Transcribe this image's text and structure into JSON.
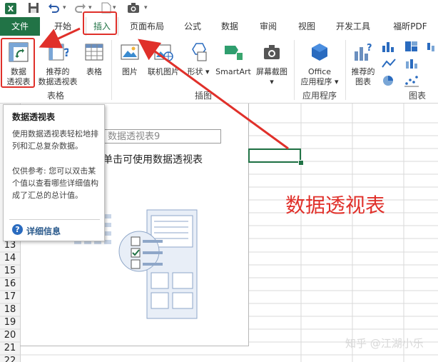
{
  "tabs": {
    "file": "文件",
    "home": "开始",
    "insert": "插入",
    "page_layout": "页面布局",
    "formulas": "公式",
    "data": "数据",
    "review": "审阅",
    "view": "视图",
    "developer": "开发工具",
    "foxit_pdf": "福昕PDF"
  },
  "ribbon": {
    "pivot_table_line1": "数据",
    "pivot_table_line2": "透视表",
    "recommended_pivot_line1": "推荐的",
    "recommended_pivot_line2": "数据透视表",
    "table": "表格",
    "tables_group": "表格",
    "pictures": "图片",
    "online_pictures": "联机图片",
    "shapes": "形状",
    "smartart": "SmartArt",
    "screenshot": "屏幕截图",
    "illustrations_group": "插图",
    "office_apps_line1": "Office",
    "office_apps_line2": "应用程序",
    "apps_group": "应用程序",
    "recommended_charts_line1": "推荐的",
    "recommended_charts_line2": "图表",
    "charts_group": "图表"
  },
  "grid": {
    "rows": [
      "13",
      "14",
      "15",
      "16",
      "17",
      "18",
      "19",
      "20",
      "21",
      "22"
    ]
  },
  "pivot_placeholder": {
    "name": "数据透视表9",
    "instruction": "单击可使用数据透视表"
  },
  "tooltip": {
    "title": "数据透视表",
    "description": "使用数据透视表轻松地排列和汇总复杂数据。",
    "note": "仅供参考: 您可以双击某个值以查看哪些详细值构成了汇总的总计值。",
    "more_info": "详细信息"
  },
  "annotation": {
    "label": "数据透视表"
  },
  "watermark": "知乎 @江湖小乐",
  "colors": {
    "excel_green": "#217346",
    "annotation_red": "#e0302a"
  }
}
